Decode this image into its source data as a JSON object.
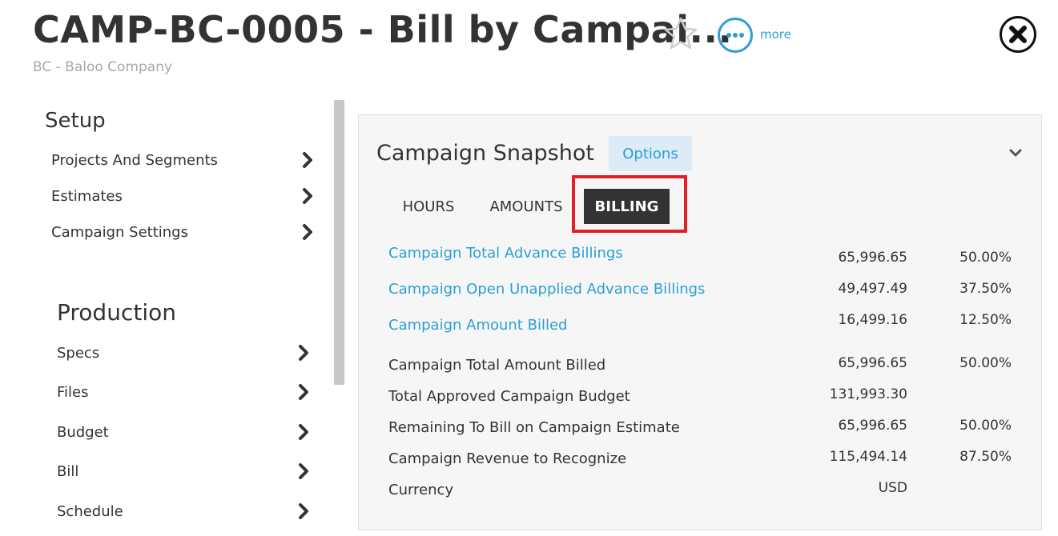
{
  "header": {
    "title": "CAMP-BC-0005 - Bill by Campai...",
    "company": "BC - Baloo Company",
    "more_label": "more"
  },
  "nav": {
    "setup_heading": "Setup",
    "setup_items": [
      {
        "label": "Projects And Segments"
      },
      {
        "label": "Estimates"
      },
      {
        "label": "Campaign Settings"
      }
    ],
    "production_heading": "Production",
    "production_items": [
      {
        "label": "Specs"
      },
      {
        "label": "Files"
      },
      {
        "label": "Budget"
      },
      {
        "label": "Bill"
      },
      {
        "label": "Schedule"
      }
    ]
  },
  "snapshot": {
    "title": "Campaign Snapshot",
    "options_label": "Options",
    "tabs": [
      {
        "label": "HOURS"
      },
      {
        "label": "AMOUNTS"
      },
      {
        "label": "BILLING"
      }
    ],
    "active_tab": "BILLING",
    "rows": [
      {
        "label": "Campaign Total Advance Billings",
        "value": "65,996.65",
        "pct": "50.00%"
      },
      {
        "label": "Campaign Open Unapplied Advance Billings",
        "value": "49,497.49",
        "pct": "37.50%"
      },
      {
        "label": "Campaign Amount Billed",
        "value": "16,499.16",
        "pct": "12.50%"
      },
      {
        "label": "Campaign Total Amount Billed",
        "value": "65,996.65",
        "pct": "50.00%"
      },
      {
        "label": "Total Approved Campaign Budget",
        "value": "131,993.30",
        "pct": ""
      },
      {
        "label": "Remaining To Bill on Campaign Estimate",
        "value": "65,996.65",
        "pct": "50.00%"
      },
      {
        "label": "Campaign Revenue to Recognize",
        "value": "115,494.14",
        "pct": "87.50%"
      },
      {
        "label": "Currency",
        "value": "USD",
        "pct": ""
      }
    ]
  },
  "colors": {
    "link": "#2a9fd6",
    "active_tab_bg": "#333333",
    "highlight": "#e01f26",
    "options_bg": "#dcebf5"
  }
}
